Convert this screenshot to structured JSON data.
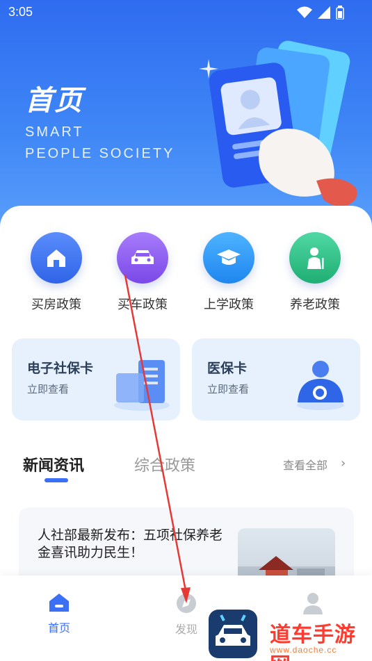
{
  "status_bar": {
    "time": "3:05"
  },
  "hero": {
    "title": "首页",
    "subtitle_line1": "SMART",
    "subtitle_line2": "PEOPLE SOCIETY"
  },
  "quick_actions": [
    {
      "label": "买房政策",
      "icon": "house-icon",
      "color": "#3d78f0"
    },
    {
      "label": "买车政策",
      "icon": "car-icon",
      "color": "#8a5cf0"
    },
    {
      "label": "上学政策",
      "icon": "graduation-cap-icon",
      "color": "#2d9cf5"
    },
    {
      "label": "养老政策",
      "icon": "elderly-person-icon",
      "color": "#2cc58a"
    }
  ],
  "service_cards": [
    {
      "title": "电子社保卡",
      "subtitle": "立即查看"
    },
    {
      "title": "医保卡",
      "subtitle": "立即查看"
    }
  ],
  "tabs": {
    "active": "新闻资讯",
    "inactive": "综合政策",
    "view_all": "查看全部"
  },
  "news": [
    {
      "title": "人社部最新发布：五项社保养老金喜讯助力民生！"
    }
  ],
  "bottom_nav": [
    {
      "label": "首页",
      "icon": "home-icon",
      "active": true
    },
    {
      "label": "发现",
      "icon": "compass-icon",
      "active": false
    },
    {
      "label": "",
      "icon": "profile-icon",
      "active": false
    }
  ],
  "watermark": {
    "text": "道车手游网",
    "url": "www.daoche.cc"
  },
  "colors": {
    "accent": "#3b6ff5",
    "hero_top": "#2f6cf0",
    "hero_bottom": "#5aa0fb",
    "arrow": "#e53935"
  }
}
